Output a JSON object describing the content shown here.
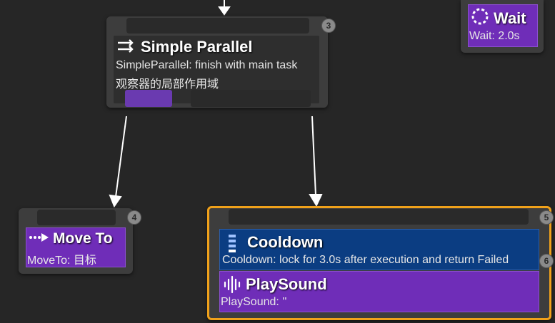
{
  "nodes": {
    "simple_parallel": {
      "title": "Simple Parallel",
      "line1": "SimpleParallel: finish with main task",
      "line2": "观察器的局部作用域",
      "badge": "3"
    },
    "wait": {
      "title": "Wait",
      "subtitle": "Wait: 2.0s"
    },
    "move_to": {
      "title": "Move To",
      "subtitle": "MoveTo: 目标",
      "badge": "4"
    },
    "cooldown": {
      "title": "Cooldown",
      "subtitle": "Cooldown: lock for 3.0s after execution and return Failed",
      "badge": "5",
      "badge2": "6"
    },
    "playsound": {
      "title": "PlaySound",
      "subtitle": "PlaySound: ''"
    }
  },
  "colors": {
    "background": "#262626",
    "node": "#3d3d3d",
    "task_purple": "#6f2db8",
    "decorator_blue": "#0b3d82",
    "selection_orange": "#f0a11a"
  },
  "icons": {
    "simple_parallel": "parallel-arrows-icon",
    "wait": "wait-dial-icon",
    "move_to": "move-arrow-icon",
    "cooldown": "cooldown-bars-icon",
    "playsound": "sound-wave-icon"
  }
}
